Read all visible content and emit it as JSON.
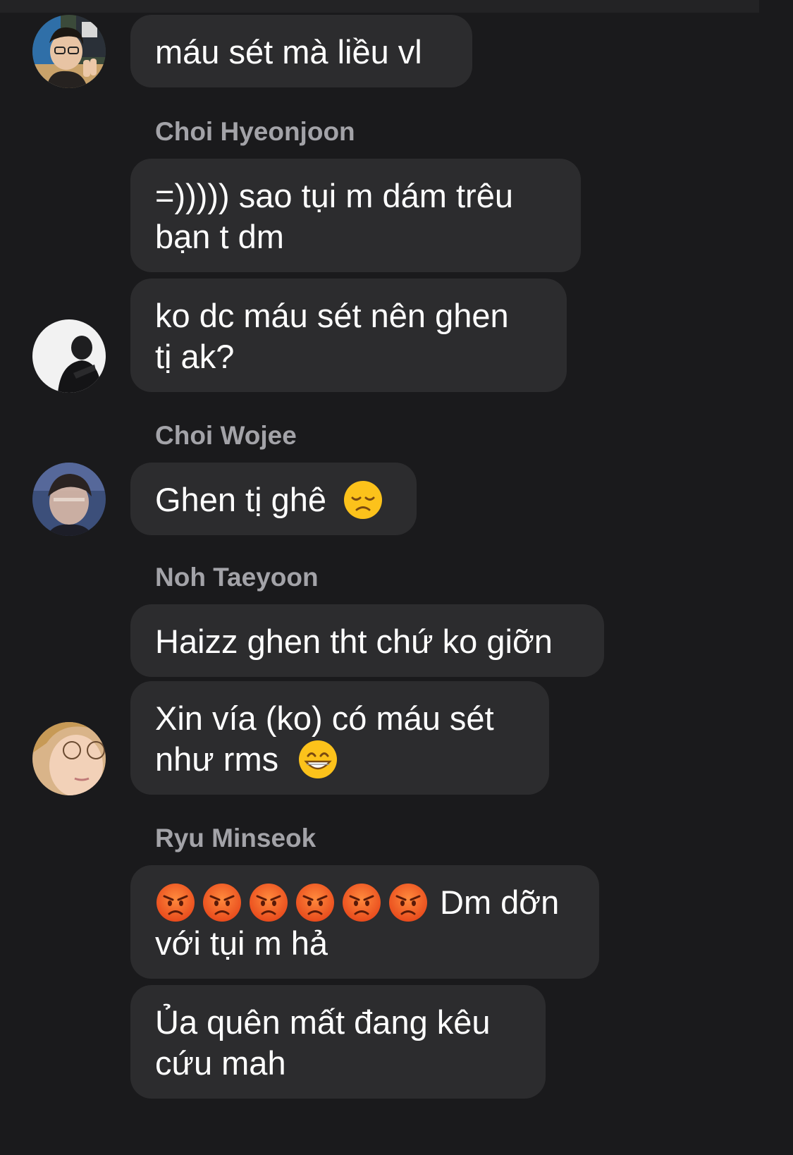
{
  "chat": {
    "senders": [
      "Choi Hyeonjoon",
      "Choi Wojee",
      "Noh Taeyoon",
      "Ryu Minseok"
    ],
    "messages": [
      {
        "lines": [
          "máu sét mà liều vl"
        ]
      },
      {
        "lines": [
          "=))))) sao tụi m dám trêu",
          "bạn t dm"
        ]
      },
      {
        "lines": [
          "ko dc máu sét nên ghen",
          "tị ak?"
        ]
      },
      {
        "lines": [
          "Ghen tị ghê"
        ],
        "emoji": "disappointed-face"
      },
      {
        "lines": [
          "Haizz ghen tht chứ ko giỡn"
        ]
      },
      {
        "lines": [
          "Xin vía (ko) có máu sét",
          "như rms"
        ],
        "emoji": "grinning-face"
      },
      {
        "lines": [
          "Dm dỡn",
          "với tụi m hả"
        ],
        "emoji": "pouting-face",
        "emoji_count": 6
      },
      {
        "lines": [
          "Ủa quên mất đang kêu",
          "cứu mah"
        ]
      }
    ],
    "avatars": [
      "avatar-person-peace-sign",
      "avatar-person-dark-jacket",
      "avatar-person-blurred",
      "avatar-person-glasses"
    ]
  },
  "colors": {
    "background": "#1a1a1c",
    "bubble": "#2c2c2e",
    "sender_name": "#a3a3a8",
    "message_text": "#ffffff"
  }
}
